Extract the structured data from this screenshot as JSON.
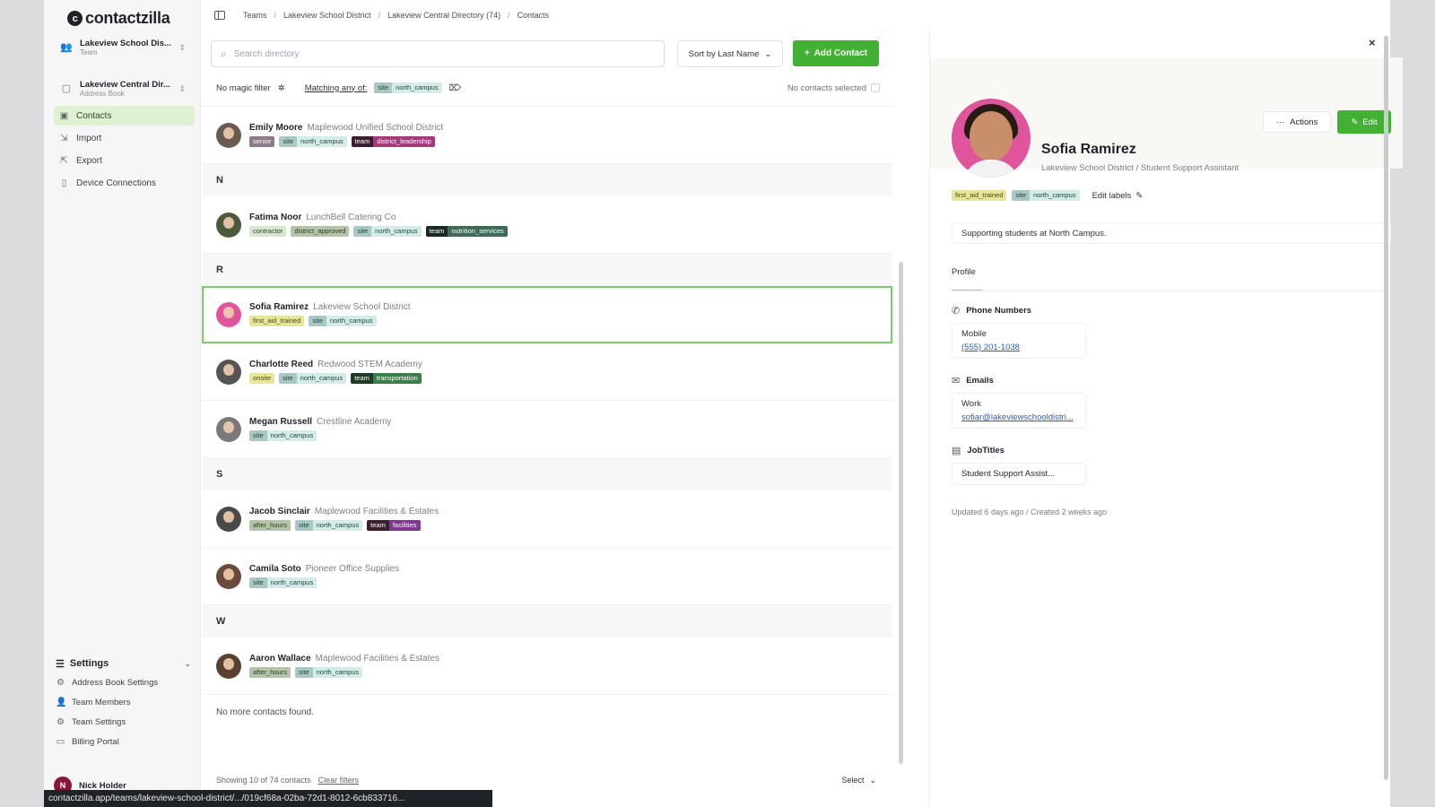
{
  "app": {
    "brand": "contactzilla"
  },
  "sidebar": {
    "team_switcher": {
      "title": "Lakeview School Dis...",
      "subtitle": "Team"
    },
    "book_switcher": {
      "title": "Lakeview Central Dir...",
      "subtitle": "Address Book"
    },
    "nav": [
      {
        "label": "Contacts",
        "icon": "contacts-icon",
        "active": true
      },
      {
        "label": "Import",
        "icon": "import-icon"
      },
      {
        "label": "Export",
        "icon": "export-icon"
      },
      {
        "label": "Device Connections",
        "icon": "device-icon"
      }
    ],
    "settings": {
      "label": "Settings",
      "items": [
        {
          "label": "Address Book Settings",
          "icon": "settings-icon"
        },
        {
          "label": "Team Members",
          "icon": "team-icon"
        },
        {
          "label": "Team Settings",
          "icon": "gear-icon"
        },
        {
          "label": "Billing Portal",
          "icon": "billing-icon"
        }
      ]
    },
    "user": {
      "name": "Nick Holder",
      "initial": "N"
    }
  },
  "breadcrumb": [
    "Teams",
    "Lakeview School District",
    "Lakeview Central Directory (74)",
    "Contacts"
  ],
  "toolbar": {
    "search_placeholder": "Search directory",
    "sort_label": "Sort by Last Name",
    "add_label": "Add Contact"
  },
  "filters": {
    "magic": "No magic filter",
    "matching": "Matching any of:",
    "chip": {
      "k": "site",
      "v": "north_campus"
    },
    "selection": "No contacts selected"
  },
  "list": {
    "rows": [
      {
        "type": "contact",
        "name": "Emily Moore",
        "org": "Maplewood Unified School District",
        "avatar": "#6b5a50",
        "tags": [
          {
            "style": "t-senior",
            "k": "senior"
          },
          {
            "style": "t-site",
            "k": "site",
            "v": "north_campus"
          },
          {
            "style": "t-team",
            "k": "team",
            "v": "district_leadership"
          }
        ]
      },
      {
        "type": "letter",
        "letter": "N"
      },
      {
        "type": "contact",
        "name": "Fatima Noor",
        "org": "LunchBell Catering Co",
        "avatar": "#4a5a3a",
        "tags": [
          {
            "style": "t-plain",
            "k": "contractor"
          },
          {
            "style": "t-olive",
            "k": "district_approved"
          },
          {
            "style": "t-site",
            "k": "site",
            "v": "north_campus"
          },
          {
            "style": "t-team4",
            "k": "team",
            "v": "nutrition_services"
          }
        ]
      },
      {
        "type": "letter",
        "letter": "R"
      },
      {
        "type": "contact",
        "name": "Sofia Ramirez",
        "org": "Lakeview School District",
        "avatar": "#e0549b",
        "selected": true,
        "tags": [
          {
            "style": "t-yellow",
            "k": "first_aid_trained"
          },
          {
            "style": "t-site",
            "k": "site",
            "v": "north_campus"
          }
        ]
      },
      {
        "type": "contact",
        "name": "Charlotte Reed",
        "org": "Redwood STEM Academy",
        "avatar": "#555",
        "tags": [
          {
            "style": "t-yellow",
            "k": "onsite"
          },
          {
            "style": "t-site",
            "k": "site",
            "v": "north_campus"
          },
          {
            "style": "t-team2",
            "k": "team",
            "v": "transportation"
          }
        ]
      },
      {
        "type": "contact",
        "name": "Megan Russell",
        "org": "Crestline Academy",
        "avatar": "#7a7a7a",
        "tags": [
          {
            "style": "t-site",
            "k": "site",
            "v": "north_campus"
          }
        ]
      },
      {
        "type": "letter",
        "letter": "S"
      },
      {
        "type": "contact",
        "name": "Jacob Sinclair",
        "org": "Maplewood Facilities & Estates",
        "avatar": "#4a4a4a",
        "tags": [
          {
            "style": "t-olive",
            "k": "after_hours"
          },
          {
            "style": "t-site",
            "k": "site",
            "v": "north_campus"
          },
          {
            "style": "t-team3",
            "k": "team",
            "v": "facilities"
          }
        ]
      },
      {
        "type": "contact",
        "name": "Camila Soto",
        "org": "Pioneer Office Supplies",
        "avatar": "#6a4a3a",
        "tags": [
          {
            "style": "t-site",
            "k": "site",
            "v": "north_campus"
          }
        ]
      },
      {
        "type": "letter",
        "letter": "W"
      },
      {
        "type": "contact",
        "name": "Aaron Wallace",
        "org": "Maplewood Facilities & Estates",
        "avatar": "#5a4030",
        "tags": [
          {
            "style": "t-olive",
            "k": "after_hours"
          },
          {
            "style": "t-site",
            "k": "site",
            "v": "north_campus"
          }
        ]
      }
    ],
    "end_text": "No more contacts found.",
    "showing": "Showing 10 of 74 contacts",
    "clear": "Clear filters",
    "select": "Select"
  },
  "detail": {
    "name": "Sofia Ramirez",
    "subtitle": "Lakeview School District / Student Support Assistant",
    "actions_label": "Actions",
    "edit_label": "Edit",
    "tags": [
      {
        "style": "t-yellow",
        "k": "first_aid_trained"
      },
      {
        "style": "t-site",
        "k": "site",
        "v": "north_campus"
      }
    ],
    "edit_labels": "Edit labels",
    "note": "Supporting students at North Campus.",
    "tab": "Profile",
    "phone": {
      "heading": "Phone Numbers",
      "label": "Mobile",
      "value": "(555) 201-1038"
    },
    "email": {
      "heading": "Emails",
      "label": "Work",
      "value": "sofiar@lakeviewschooldistri..."
    },
    "job": {
      "heading": "JobTitles",
      "value": "Student Support Assist..."
    },
    "timestamps": "Updated 6 days ago  /  Created 2 weeks ago"
  },
  "status_url": "contactzilla.app/teams/lakeview-school-district/.../019cf68a-02ba-72d1-8012-6cb833716...",
  "colors": {
    "accent": "#42b033",
    "selected_outline": "#7dcb6b"
  }
}
